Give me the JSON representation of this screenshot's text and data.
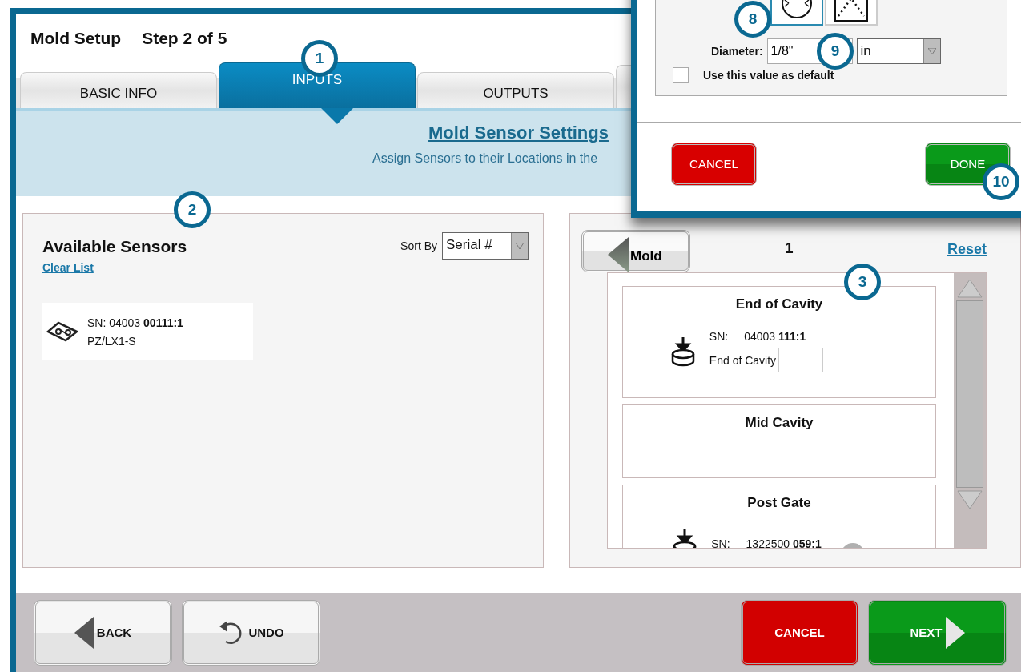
{
  "window": {
    "title": "Mold Setup",
    "step": "Step 2 of 5"
  },
  "tabs": [
    {
      "label": "BASIC INFO",
      "selected": false
    },
    {
      "label": "INPUTS",
      "selected": true
    },
    {
      "label": "OUTPUTS",
      "selected": false
    }
  ],
  "banner": {
    "title": "Mold Sensor Settings",
    "subtitle": "Assign Sensors to their Locations in the"
  },
  "available": {
    "title": "Available Sensors",
    "clear_link": "Clear List",
    "sort_label": "Sort By",
    "sort_value": "Serial #",
    "sensors": [
      {
        "sn": "SN: 04003 **00111:1**",
        "model": "PZ/LX1-S"
      }
    ]
  },
  "mold": {
    "back_label": "Mold",
    "cavity": "1",
    "reset_link": "Reset",
    "locations": [
      {
        "name": "End of Cavity",
        "sensor": {
          "sn_label": "SN:",
          "sn": "04003 **111:1**",
          "field_label": "End of Cavity"
        }
      },
      {
        "name": "Mid Cavity"
      },
      {
        "name": "Post Gate",
        "sensor": {
          "sn_label": "SN:",
          "sn": "1322500 **059:1**"
        }
      }
    ]
  },
  "footer": [
    {
      "label": "BACK",
      "kind": "back"
    },
    {
      "label": "UNDO",
      "kind": "undo"
    },
    {
      "label": "CANCEL",
      "kind": "cancel"
    },
    {
      "label": "NEXT",
      "kind": "next"
    }
  ],
  "dialog": {
    "shapes": [
      {
        "kind": "round",
        "selected": true
      },
      {
        "kind": "angled",
        "selected": false
      }
    ],
    "diameter_label": "Diameter:",
    "diameter_value": "1/8\"",
    "unit": "in",
    "default_checkbox": {
      "label": "Use this value as default",
      "checked": false
    },
    "cancel": "CANCEL",
    "done": "DONE"
  },
  "callouts": [
    {
      "label": "1"
    },
    {
      "label": "2"
    },
    {
      "label": "3"
    },
    {
      "label": "8"
    },
    {
      "label": "9"
    },
    {
      "label": "10"
    }
  ]
}
